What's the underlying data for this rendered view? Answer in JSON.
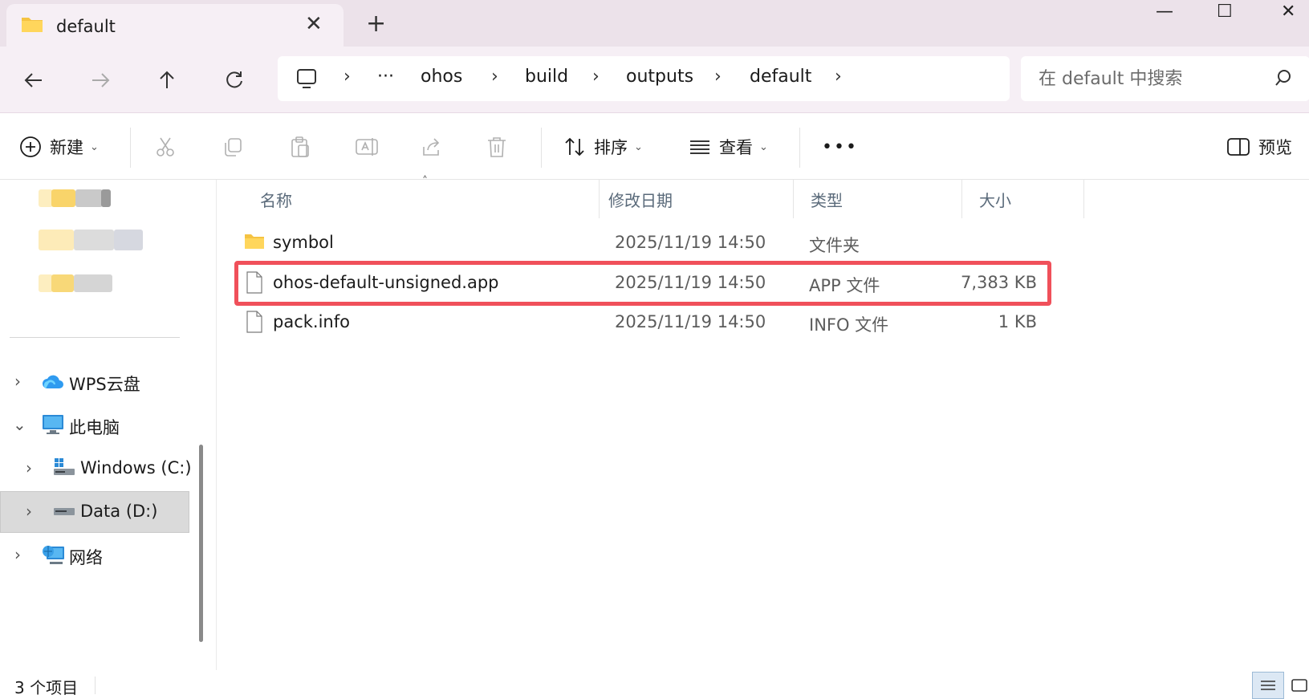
{
  "window": {
    "tab_title": "default",
    "tab_close": "✕",
    "new_tab": "+",
    "minimize": "—",
    "maximize": "☐",
    "close": "✕",
    "accent": "#f0505a"
  },
  "nav": {
    "breadcrumb": {
      "overflow": "···",
      "items": [
        "ohos",
        "build",
        "outputs",
        "default"
      ],
      "separator": "›"
    },
    "search_placeholder": "在 default 中搜索"
  },
  "toolbar": {
    "new_label": "新建",
    "sort_label": "排序",
    "view_label": "查看",
    "more_label": "•••",
    "preview_label": "预览",
    "caret": "⌄"
  },
  "sidebar": {
    "items": [
      {
        "label": "WPS云盘",
        "chevron": "›",
        "icon": "cloud-icon"
      },
      {
        "label": "此电脑",
        "chevron": "⌄",
        "icon": "computer-icon"
      },
      {
        "label": "Windows (C:)",
        "chevron": "›",
        "icon": "windows-drive-icon"
      },
      {
        "label": "Data (D:)",
        "chevron": "›",
        "icon": "drive-icon",
        "selected": true
      },
      {
        "label": "网络",
        "chevron": "›",
        "icon": "network-icon"
      }
    ]
  },
  "files": {
    "columns": {
      "name": "名称",
      "date": "修改日期",
      "type": "类型",
      "size": "大小"
    },
    "sort_indicator": "˄",
    "rows": [
      {
        "name": "symbol",
        "date": "2025/11/19 14:50",
        "type": "文件夹",
        "size": "",
        "icon": "folder-icon"
      },
      {
        "name": "ohos-default-unsigned.app",
        "date": "2025/11/19 14:50",
        "type": "APP 文件",
        "size": "7,383 KB",
        "icon": "file-icon",
        "highlighted": true
      },
      {
        "name": "pack.info",
        "date": "2025/11/19 14:50",
        "type": "INFO 文件",
        "size": "1 KB",
        "icon": "file-icon"
      }
    ]
  },
  "status": {
    "item_count": "3 个项目"
  }
}
